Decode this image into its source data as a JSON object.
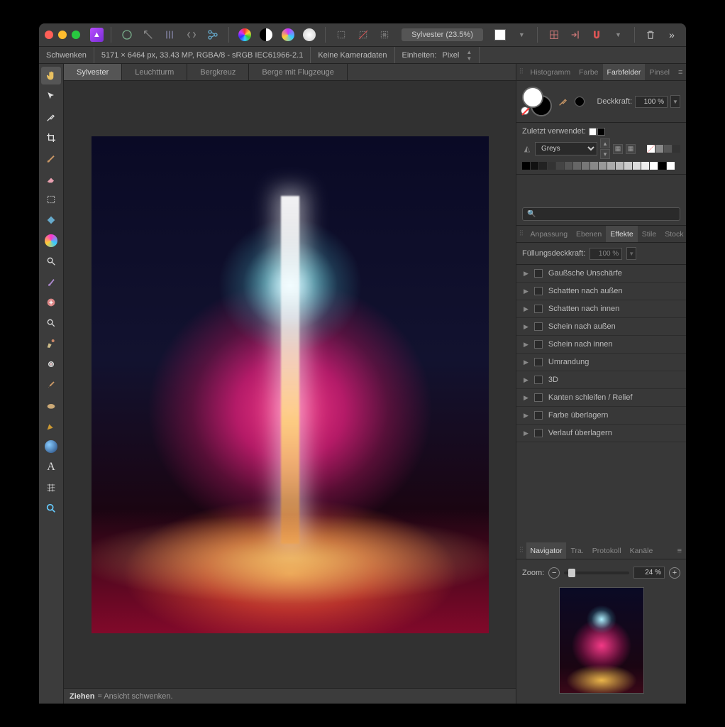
{
  "window": {
    "doc_title": "Sylvester (23.5%)"
  },
  "infobar": {
    "tool": "Schwenken",
    "dimensions": "5171 × 6464 px, 33.43 MP, RGBA/8 - sRGB IEC61966-2.1",
    "camera": "Keine Kameradaten",
    "units_label": "Einheiten:",
    "units_value": "Pixel"
  },
  "doc_tabs": [
    "Sylvester",
    "Leuchtturm",
    "Bergkreuz",
    "Berge mit Flugzeuge"
  ],
  "doc_tab_active": 0,
  "panel_top": {
    "tabs": [
      "Histogramm",
      "Farbe",
      "Farbfelder",
      "Pinsel"
    ],
    "active": 2,
    "opacity_label": "Deckkraft:",
    "opacity_value": "100 %",
    "recent_label": "Zuletzt verwendet:",
    "palette_name": "Greys",
    "search_placeholder": "🔍"
  },
  "panel_mid": {
    "tabs": [
      "Anpassung",
      "Ebenen",
      "Effekte",
      "Stile",
      "Stock"
    ],
    "active": 2,
    "fill_label": "Füllungsdeckkraft:",
    "fill_value": "100 %",
    "effects": [
      "Gaußsche Unschärfe",
      "Schatten nach außen",
      "Schatten nach innen",
      "Schein nach außen",
      "Schein nach innen",
      "Umrandung",
      "3D",
      "Kanten schleifen / Relief",
      "Farbe überlagern",
      "Verlauf überlagern"
    ]
  },
  "panel_bottom": {
    "tabs": [
      "Navigator",
      "Tra.",
      "Protokoll",
      "Kanäle"
    ],
    "active": 0,
    "zoom_label": "Zoom:",
    "zoom_value": "24 %"
  },
  "statusbar": {
    "action": "Ziehen",
    "desc": " = Ansicht schwenken."
  },
  "greys": [
    "#000",
    "#111",
    "#222",
    "#333",
    "#444",
    "#555",
    "#666",
    "#777",
    "#888",
    "#999",
    "#aaa",
    "#bbb",
    "#ccc",
    "#ddd",
    "#eee",
    "#fff",
    "#000",
    "#fff"
  ],
  "recent_sw": [
    "#fff",
    "#000"
  ],
  "corner_sw": [
    "#fff",
    "#888",
    "#555",
    "#333"
  ]
}
